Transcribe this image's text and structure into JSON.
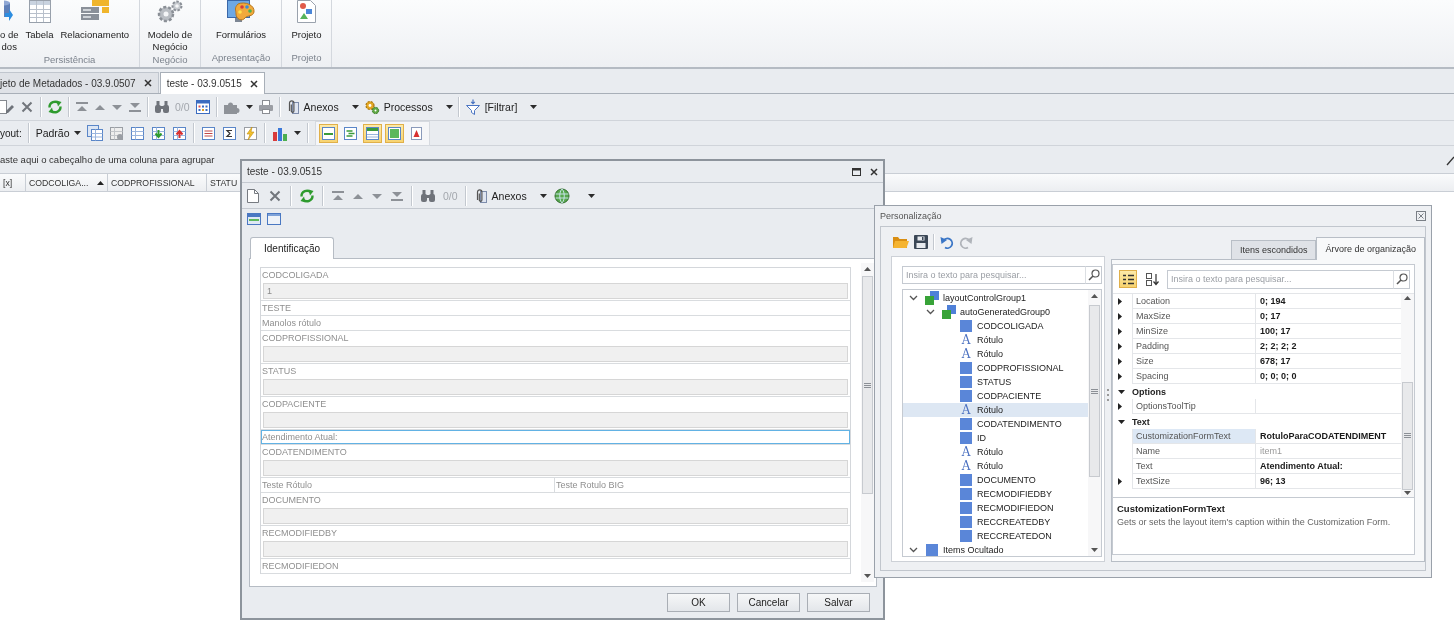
{
  "ribbon": {
    "groups": [
      {
        "caption": "Persistência",
        "buttons": [
          {
            "label": "o de\ndos"
          },
          {
            "label": "Tabela"
          },
          {
            "label": "Relacionamento"
          }
        ]
      },
      {
        "caption": "Negócio",
        "buttons": [
          {
            "label": "Modelo de\nNegócio"
          }
        ]
      },
      {
        "caption": "Apresentação",
        "buttons": [
          {
            "label": "Formulários"
          }
        ]
      },
      {
        "caption": "Projeto",
        "buttons": [
          {
            "label": "Projeto"
          }
        ]
      }
    ]
  },
  "document_tabs": [
    {
      "label": "jeto de Metadados - 03.9.0507",
      "selected": false
    },
    {
      "label": "teste - 03.9.0515",
      "selected": true
    }
  ],
  "toolbar": {
    "counter": {
      "text": "0/0",
      "disabled": true
    },
    "menus": [
      {
        "label": "Anexos"
      },
      {
        "label": "Processos"
      },
      {
        "label": "[Filtrar]"
      }
    ]
  },
  "layout_toolbar": {
    "label": "yout:",
    "preset": "Padrão",
    "toggles": [
      {
        "on": true
      },
      {
        "on": false
      },
      {
        "on": true
      },
      {
        "on": true
      },
      {
        "on": false
      }
    ]
  },
  "group_panel": {
    "hint": "aste aqui o cabeçalho de uma coluna para agrupar"
  },
  "grid": {
    "columns": [
      {
        "label": "[x]",
        "sorted": false
      },
      {
        "label": "CODCOLIGA...",
        "sorted": true
      },
      {
        "label": "CODPROFISSIONAL",
        "sorted": false
      },
      {
        "label": "STATU",
        "sorted": false
      }
    ]
  },
  "form_window": {
    "title": "teste - 03.9.0515",
    "toolbar": {
      "counter": {
        "text": "0/0",
        "disabled": true
      },
      "menus": [
        {
          "label": "Anexos"
        }
      ]
    },
    "tabs": [
      {
        "label": "Identificação",
        "selected": true
      }
    ],
    "fields": [
      {
        "kind": "field",
        "label": "CODCOLIGADA",
        "value": "1",
        "selected": false
      },
      {
        "kind": "label",
        "label": "TESTE",
        "selected": false
      },
      {
        "kind": "label",
        "label": "Manolos rótulo",
        "selected": false
      },
      {
        "kind": "field",
        "label": "CODPROFISSIONAL",
        "selected": false
      },
      {
        "kind": "field",
        "label": "STATUS",
        "selected": false
      },
      {
        "kind": "field",
        "label": "CODPACIENTE",
        "selected": false
      },
      {
        "kind": "label",
        "label": "Atendimento Atual:",
        "selected": true
      },
      {
        "kind": "field",
        "label": "CODATENDIMENTO",
        "selected": false
      },
      {
        "kind": "label_pair",
        "items": [
          {
            "label": "Teste Rótulo",
            "selected": false
          },
          {
            "label": "Teste Rotulo BIG",
            "selected": false
          }
        ]
      },
      {
        "kind": "field",
        "label": "DOCUMENTO",
        "selected": false
      },
      {
        "kind": "field",
        "label": "RECMODIFIEDBY",
        "selected": false
      },
      {
        "kind": "label",
        "label": "RECMODIFIEDON",
        "selected": false
      }
    ],
    "buttons": [
      {
        "label": "OK"
      },
      {
        "label": "Cancelar"
      },
      {
        "label": "Salvar"
      }
    ]
  },
  "customization_window": {
    "title": "Personalização",
    "history_buttons": [
      {
        "disabled": false
      },
      {
        "disabled": true
      }
    ],
    "tree": {
      "search_placeholder": "Insira o texto para pesquisar...",
      "items": [
        {
          "label": "layoutControlGroup1",
          "kind": "group",
          "expanded": true,
          "selected": false,
          "children": [
            {
              "label": "autoGeneratedGroup0",
              "kind": "group",
              "expanded": true,
              "selected": false,
              "children": [
                {
                  "label": "CODCOLIGADA",
                  "kind": "item",
                  "selected": false
                },
                {
                  "label": "Rótulo",
                  "kind": "label",
                  "glyph": "A",
                  "selected": false
                },
                {
                  "label": "Rótulo",
                  "kind": "label",
                  "glyph": "A",
                  "selected": false
                },
                {
                  "label": "CODPROFISSIONAL",
                  "kind": "item",
                  "selected": false
                },
                {
                  "label": "STATUS",
                  "kind": "item",
                  "selected": false
                },
                {
                  "label": "CODPACIENTE",
                  "kind": "item",
                  "selected": false
                },
                {
                  "label": "Rótulo",
                  "kind": "label",
                  "glyph": "A",
                  "selected": true
                },
                {
                  "label": "CODATENDIMENTO",
                  "kind": "item",
                  "selected": false
                },
                {
                  "label": "ID",
                  "kind": "item",
                  "selected": false
                },
                {
                  "label": "Rótulo",
                  "kind": "label",
                  "glyph": "A",
                  "selected": false
                },
                {
                  "label": "Rótulo",
                  "kind": "label",
                  "glyph": "A",
                  "selected": false
                },
                {
                  "label": "DOCUMENTO",
                  "kind": "item",
                  "selected": false
                },
                {
                  "label": "RECMODIFIEDBY",
                  "kind": "item",
                  "selected": false
                },
                {
                  "label": "RECMODIFIEDON",
                  "kind": "item",
                  "selected": false
                },
                {
                  "label": "RECCREATEDBY",
                  "kind": "item",
                  "selected": false
                },
                {
                  "label": "RECCREATEDON",
                  "kind": "item",
                  "selected": false
                }
              ]
            }
          ]
        },
        {
          "label": "Items Ocultado",
          "kind": "hidden_group",
          "expanded": true,
          "selected": false
        }
      ]
    },
    "tabs": [
      {
        "label": "Itens escondidos",
        "selected": false
      },
      {
        "label": "Árvore de organização",
        "selected": true
      }
    ],
    "property_grid": {
      "view_buttons": [
        {
          "on": true
        },
        {
          "on": false
        }
      ],
      "search_placeholder": "Insira o texto para pesquisar...",
      "rows": [
        {
          "kind": "property",
          "name": "Location",
          "value": "0; 194",
          "expandable": true,
          "modified": true,
          "selected": false
        },
        {
          "kind": "property",
          "name": "MaxSize",
          "value": "0; 17",
          "expandable": true,
          "modified": true,
          "selected": false
        },
        {
          "kind": "property",
          "name": "MinSize",
          "value": "100; 17",
          "expandable": true,
          "modified": true,
          "selected": false
        },
        {
          "kind": "property",
          "name": "Padding",
          "value": "2; 2; 2; 2",
          "expandable": true,
          "modified": true,
          "selected": false
        },
        {
          "kind": "property",
          "name": "Size",
          "value": "678; 17",
          "expandable": true,
          "modified": true,
          "selected": false
        },
        {
          "kind": "property",
          "name": "Spacing",
          "value": "0; 0; 0; 0",
          "expandable": true,
          "modified": true,
          "selected": false
        },
        {
          "kind": "category",
          "name": "Options",
          "expanded": true,
          "selected": false
        },
        {
          "kind": "property",
          "name": "OptionsToolTip",
          "expandable": true,
          "selected": false
        },
        {
          "kind": "category",
          "name": "Text",
          "expanded": true,
          "selected": false
        },
        {
          "kind": "property",
          "name": "CustomizationFormText",
          "value": "RotuloParaCODATENDIMENT",
          "expandable": false,
          "modified": true,
          "selected": true
        },
        {
          "kind": "property",
          "name": "Name",
          "value": "item1",
          "expandable": false,
          "modified": false,
          "selected": false
        },
        {
          "kind": "property",
          "name": "Text",
          "value": "Atendimento Atual:",
          "expandable": false,
          "modified": true,
          "selected": false
        },
        {
          "kind": "property",
          "name": "TextSize",
          "value": "96; 13",
          "expandable": true,
          "modified": true,
          "selected": false
        }
      ],
      "description": {
        "title": "CustomizationFormText",
        "text": "Gets or sets the layout item's caption within the Customization Form."
      }
    }
  }
}
